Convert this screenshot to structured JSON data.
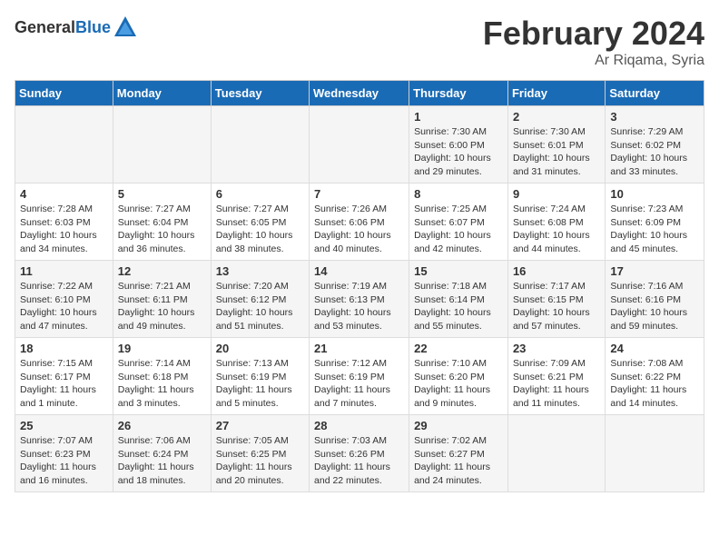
{
  "header": {
    "logo_general": "General",
    "logo_blue": "Blue",
    "main_title": "February 2024",
    "subtitle": "Ar Riqama, Syria"
  },
  "calendar": {
    "days_of_week": [
      "Sunday",
      "Monday",
      "Tuesday",
      "Wednesday",
      "Thursday",
      "Friday",
      "Saturday"
    ],
    "weeks": [
      [
        {
          "day": "",
          "info": ""
        },
        {
          "day": "",
          "info": ""
        },
        {
          "day": "",
          "info": ""
        },
        {
          "day": "",
          "info": ""
        },
        {
          "day": "1",
          "info": "Sunrise: 7:30 AM\nSunset: 6:00 PM\nDaylight: 10 hours\nand 29 minutes."
        },
        {
          "day": "2",
          "info": "Sunrise: 7:30 AM\nSunset: 6:01 PM\nDaylight: 10 hours\nand 31 minutes."
        },
        {
          "day": "3",
          "info": "Sunrise: 7:29 AM\nSunset: 6:02 PM\nDaylight: 10 hours\nand 33 minutes."
        }
      ],
      [
        {
          "day": "4",
          "info": "Sunrise: 7:28 AM\nSunset: 6:03 PM\nDaylight: 10 hours\nand 34 minutes."
        },
        {
          "day": "5",
          "info": "Sunrise: 7:27 AM\nSunset: 6:04 PM\nDaylight: 10 hours\nand 36 minutes."
        },
        {
          "day": "6",
          "info": "Sunrise: 7:27 AM\nSunset: 6:05 PM\nDaylight: 10 hours\nand 38 minutes."
        },
        {
          "day": "7",
          "info": "Sunrise: 7:26 AM\nSunset: 6:06 PM\nDaylight: 10 hours\nand 40 minutes."
        },
        {
          "day": "8",
          "info": "Sunrise: 7:25 AM\nSunset: 6:07 PM\nDaylight: 10 hours\nand 42 minutes."
        },
        {
          "day": "9",
          "info": "Sunrise: 7:24 AM\nSunset: 6:08 PM\nDaylight: 10 hours\nand 44 minutes."
        },
        {
          "day": "10",
          "info": "Sunrise: 7:23 AM\nSunset: 6:09 PM\nDaylight: 10 hours\nand 45 minutes."
        }
      ],
      [
        {
          "day": "11",
          "info": "Sunrise: 7:22 AM\nSunset: 6:10 PM\nDaylight: 10 hours\nand 47 minutes."
        },
        {
          "day": "12",
          "info": "Sunrise: 7:21 AM\nSunset: 6:11 PM\nDaylight: 10 hours\nand 49 minutes."
        },
        {
          "day": "13",
          "info": "Sunrise: 7:20 AM\nSunset: 6:12 PM\nDaylight: 10 hours\nand 51 minutes."
        },
        {
          "day": "14",
          "info": "Sunrise: 7:19 AM\nSunset: 6:13 PM\nDaylight: 10 hours\nand 53 minutes."
        },
        {
          "day": "15",
          "info": "Sunrise: 7:18 AM\nSunset: 6:14 PM\nDaylight: 10 hours\nand 55 minutes."
        },
        {
          "day": "16",
          "info": "Sunrise: 7:17 AM\nSunset: 6:15 PM\nDaylight: 10 hours\nand 57 minutes."
        },
        {
          "day": "17",
          "info": "Sunrise: 7:16 AM\nSunset: 6:16 PM\nDaylight: 10 hours\nand 59 minutes."
        }
      ],
      [
        {
          "day": "18",
          "info": "Sunrise: 7:15 AM\nSunset: 6:17 PM\nDaylight: 11 hours\nand 1 minute."
        },
        {
          "day": "19",
          "info": "Sunrise: 7:14 AM\nSunset: 6:18 PM\nDaylight: 11 hours\nand 3 minutes."
        },
        {
          "day": "20",
          "info": "Sunrise: 7:13 AM\nSunset: 6:19 PM\nDaylight: 11 hours\nand 5 minutes."
        },
        {
          "day": "21",
          "info": "Sunrise: 7:12 AM\nSunset: 6:19 PM\nDaylight: 11 hours\nand 7 minutes."
        },
        {
          "day": "22",
          "info": "Sunrise: 7:10 AM\nSunset: 6:20 PM\nDaylight: 11 hours\nand 9 minutes."
        },
        {
          "day": "23",
          "info": "Sunrise: 7:09 AM\nSunset: 6:21 PM\nDaylight: 11 hours\nand 11 minutes."
        },
        {
          "day": "24",
          "info": "Sunrise: 7:08 AM\nSunset: 6:22 PM\nDaylight: 11 hours\nand 14 minutes."
        }
      ],
      [
        {
          "day": "25",
          "info": "Sunrise: 7:07 AM\nSunset: 6:23 PM\nDaylight: 11 hours\nand 16 minutes."
        },
        {
          "day": "26",
          "info": "Sunrise: 7:06 AM\nSunset: 6:24 PM\nDaylight: 11 hours\nand 18 minutes."
        },
        {
          "day": "27",
          "info": "Sunrise: 7:05 AM\nSunset: 6:25 PM\nDaylight: 11 hours\nand 20 minutes."
        },
        {
          "day": "28",
          "info": "Sunrise: 7:03 AM\nSunset: 6:26 PM\nDaylight: 11 hours\nand 22 minutes."
        },
        {
          "day": "29",
          "info": "Sunrise: 7:02 AM\nSunset: 6:27 PM\nDaylight: 11 hours\nand 24 minutes."
        },
        {
          "day": "",
          "info": ""
        },
        {
          "day": "",
          "info": ""
        }
      ]
    ]
  }
}
